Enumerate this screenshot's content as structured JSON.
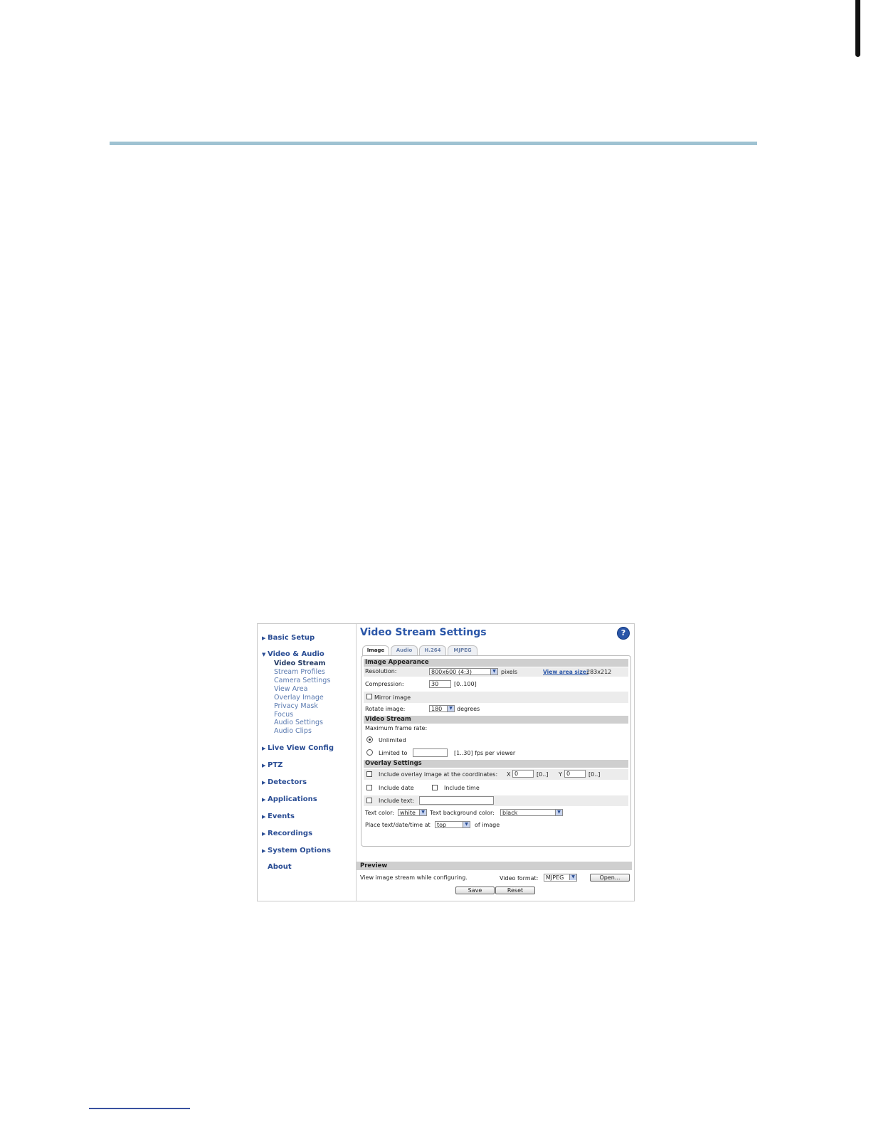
{
  "nav": {
    "groups": [
      {
        "label": "Basic Setup"
      },
      {
        "label": "Video & Audio"
      },
      {
        "label": "Live View Config"
      },
      {
        "label": "PTZ"
      },
      {
        "label": "Detectors"
      },
      {
        "label": "Applications"
      },
      {
        "label": "Events"
      },
      {
        "label": "Recordings"
      },
      {
        "label": "System Options"
      },
      {
        "label": "About"
      }
    ],
    "subitems": [
      "Video Stream",
      "Stream Profiles",
      "Camera Settings",
      "View Area",
      "Overlay Image",
      "Privacy Mask",
      "Focus",
      "Audio Settings",
      "Audio Clips"
    ]
  },
  "page": {
    "title": "Video Stream Settings",
    "help": "?"
  },
  "tabs": [
    "Image",
    "Audio",
    "H.264",
    "MJPEG"
  ],
  "image_appearance": {
    "heading": "Image Appearance",
    "resolution_label": "Resolution:",
    "resolution_value": "800x600 (4:3)",
    "resolution_unit": "pixels",
    "view_area_link": "View area size:",
    "view_area_value": "283x212",
    "compression_label": "Compression:",
    "compression_value": "30",
    "compression_range": "[0..100]",
    "mirror_label": "Mirror image",
    "rotate_label": "Rotate image:",
    "rotate_value": "180",
    "rotate_unit": "degrees"
  },
  "video_stream": {
    "heading": "Video Stream",
    "max_frame_label": "Maximum frame rate:",
    "unlimited_label": "Unlimited",
    "limited_label": "Limited to",
    "limited_range": "[1..30] fps per viewer"
  },
  "overlay": {
    "heading": "Overlay Settings",
    "include_overlay_label": "Include overlay image at the coordinates:",
    "x_label": "X",
    "x_value": "0",
    "x_range": "[0..]",
    "y_label": "Y",
    "y_value": "0",
    "y_range": "[0..]",
    "include_date": "Include date",
    "include_time": "Include time",
    "include_text": "Include text:",
    "text_color_label": "Text color:",
    "text_color_value": "white",
    "text_bg_label": "Text background color:",
    "text_bg_value": "black",
    "place_label": "Place text/date/time at",
    "place_value": "top",
    "place_suffix": "of image"
  },
  "preview": {
    "heading": "Preview",
    "description": "View image stream while configuring.",
    "format_label": "Video format:",
    "format_value": "MJPEG",
    "open_button": "Open...",
    "save_button": "Save",
    "reset_button": "Reset"
  },
  "colors": {
    "nav_link": "#2a4d94",
    "title": "#2a56a8",
    "rule": "#9fc2d2"
  }
}
